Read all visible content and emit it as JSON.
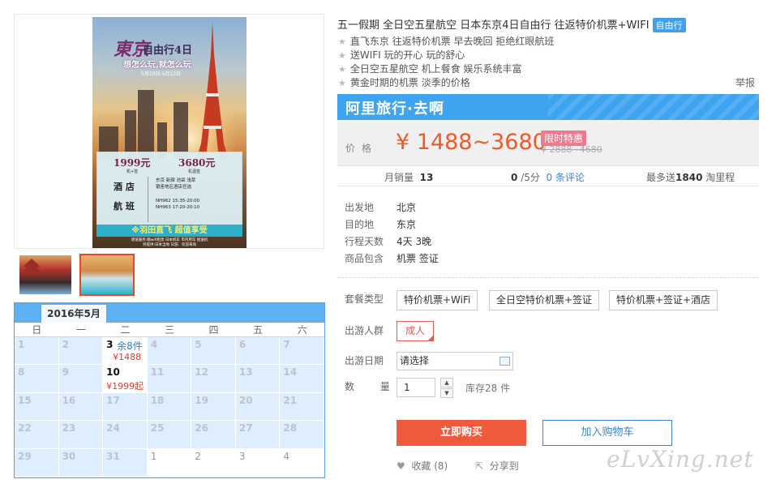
{
  "poster": {
    "title_cn": "東京",
    "title_suffix": "自由行4日",
    "slogan": "想怎么玩,就怎么玩",
    "dates": "5月10日-5月13日",
    "price_a": "1999元",
    "price_a_note": "机+签",
    "price_b": "3680元",
    "price_b_note": "机酒签",
    "hotel_label": "酒 店",
    "hotel_text": "东京  新宿  池袋  浅草\n银座地区酒店任选",
    "flight_label": "航 班",
    "flight_text": "NH962  15:35-20:00\nNH963  17:20-20:10",
    "ribbon": "※羽田直飞    超值享受",
    "footer": "增值服务:赠wifi租赁  日本机车 市内用车 接送机\n另提供:日本当地 日游、欢迎来询"
  },
  "calendar": {
    "month": "2016年5月",
    "weekdays": [
      "日",
      "一",
      "二",
      "三",
      "四",
      "五",
      "六"
    ],
    "cells": [
      {
        "day": "1",
        "state": "past"
      },
      {
        "day": "2",
        "state": "past"
      },
      {
        "day": "3",
        "state": "active",
        "stock": "余8件",
        "price": "¥1488"
      },
      {
        "day": "4",
        "state": "past"
      },
      {
        "day": "5",
        "state": "past"
      },
      {
        "day": "6",
        "state": "past"
      },
      {
        "day": "7",
        "state": "past"
      },
      {
        "day": "8",
        "state": "past"
      },
      {
        "day": "9",
        "state": "past"
      },
      {
        "day": "10",
        "state": "active",
        "stock": "",
        "price": "¥1999起"
      },
      {
        "day": "11",
        "state": "past"
      },
      {
        "day": "12",
        "state": "past"
      },
      {
        "day": "13",
        "state": "past"
      },
      {
        "day": "14",
        "state": "past"
      },
      {
        "day": "15",
        "state": "past"
      },
      {
        "day": "16",
        "state": "past"
      },
      {
        "day": "17",
        "state": "past"
      },
      {
        "day": "18",
        "state": "past"
      },
      {
        "day": "19",
        "state": "past"
      },
      {
        "day": "20",
        "state": "past"
      },
      {
        "day": "21",
        "state": "past"
      },
      {
        "day": "22",
        "state": "past"
      },
      {
        "day": "23",
        "state": "past"
      },
      {
        "day": "24",
        "state": "past"
      },
      {
        "day": "25",
        "state": "past"
      },
      {
        "day": "26",
        "state": "past"
      },
      {
        "day": "27",
        "state": "past"
      },
      {
        "day": "28",
        "state": "past"
      },
      {
        "day": "29",
        "state": "past"
      },
      {
        "day": "30",
        "state": "past"
      },
      {
        "day": "31",
        "state": "past"
      },
      {
        "day": "1",
        "state": "next"
      },
      {
        "day": "2",
        "state": "next"
      },
      {
        "day": "3",
        "state": "next"
      },
      {
        "day": "4",
        "state": "next"
      }
    ]
  },
  "product": {
    "title": "五一假期 全日空五星航空 日本东京4日自由行 往返特价机票+WIFI",
    "tag": "自由行",
    "features": [
      "直飞东京 往返特价机票 早去晚回 拒绝红眼航班",
      "送WIFI 玩的开心 玩的舒心",
      "全日空五星航空 机上餐食 娱乐系统丰富",
      "黄金时期的机票 淡季的价格"
    ],
    "report": "举报",
    "brand": "阿里旅行·去啊",
    "price_label": "价格",
    "price": "¥ 1488~3680",
    "price_tag": "限时特惠",
    "price_old": "¥ 2888~4680",
    "stats": {
      "monthly_label": "月销量",
      "monthly_value": "13",
      "rating_value": "0",
      "rating_suffix": "/5分",
      "reviews_link": "0 条评论",
      "points_prefix": "最多送",
      "points_value": "1840",
      "points_suffix": "淘里程"
    },
    "props": [
      {
        "key": "出发地",
        "value": "北京"
      },
      {
        "key": "目的地",
        "value": "东京"
      },
      {
        "key": "行程天数",
        "value": "4天 3晚"
      },
      {
        "key": "商品包含",
        "value": "机票  签证"
      }
    ],
    "package_label": "套餐类型",
    "packages": [
      "特价机票+WiFi",
      "全日空特价机票+签证",
      "特价机票+签证+酒店"
    ],
    "traveler_label": "出游人群",
    "traveler": "成人",
    "date_label": "出游日期",
    "date_placeholder": "请选择",
    "qty_label": "数 量",
    "qty": "1",
    "stock": "库存28 件",
    "buy": "立即购买",
    "cart": "加入购物车",
    "fav": "收藏 (8)",
    "share": "分享到"
  },
  "watermark": "eLvXing.net",
  "colors": {
    "accent_blue": "#3ea4f0",
    "price_orange": "#f05a28",
    "buy_red": "#f05a3c",
    "promo_pink": "#f07a8c"
  }
}
